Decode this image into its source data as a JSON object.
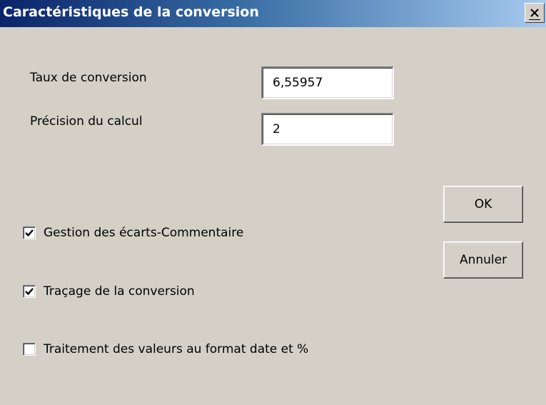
{
  "dialog": {
    "title": "Caractéristiques de la conversion"
  },
  "fields": {
    "taux_label": "Taux de conversion",
    "taux_value": "6,55957",
    "precision_label": "Précision du calcul",
    "precision_value": "2"
  },
  "options": [
    {
      "label": "Gestion des écarts-Commentaire",
      "checked": true
    },
    {
      "label": "Traçage de la conversion",
      "checked": true
    },
    {
      "label": "Traitement des valeurs au format date et %",
      "checked": false
    }
  ],
  "buttons": {
    "ok_label": "OK",
    "cancel_label": "Annuler"
  },
  "icons": {
    "close": "close-icon",
    "check": "checkmark-icon"
  },
  "colors": {
    "face": "#d4d0c8",
    "title_start": "#0a246a",
    "title_end": "#a6caf0"
  }
}
